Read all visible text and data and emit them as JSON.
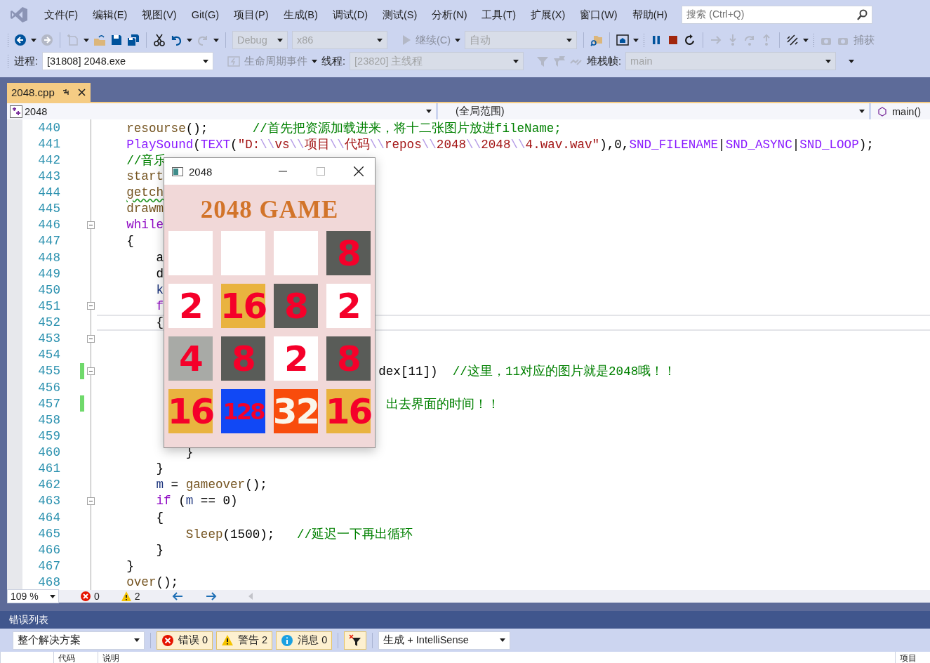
{
  "menu": {
    "items": [
      "文件(F)",
      "编辑(E)",
      "视图(V)",
      "Git(G)",
      "项目(P)",
      "生成(B)",
      "调试(D)",
      "测试(S)",
      "分析(N)",
      "工具(T)",
      "扩展(X)",
      "窗口(W)",
      "帮助(H)"
    ],
    "search": {
      "placeholder": "搜索 (Ctrl+Q)"
    }
  },
  "toolbar": {
    "configuration": {
      "value": "Debug",
      "disabled": true
    },
    "platform": {
      "value": "x86",
      "disabled": true
    },
    "continue": {
      "label": "继续(C)",
      "disabled": true
    },
    "auto": {
      "value": "自动",
      "disabled": true
    },
    "capture": {
      "label": "捕获",
      "disabled": true
    }
  },
  "debug_location": {
    "process_label": "进程:",
    "process": {
      "value": "[31808] 2048.exe",
      "disabled": false
    },
    "lifecycle": "生命周期事件",
    "thread_label": "线程:",
    "thread": {
      "value": "[23820] 主线程",
      "disabled": true
    },
    "stack_label": "堆栈帧:",
    "stack": {
      "value": "main",
      "disabled": true
    }
  },
  "document_tabs": [
    {
      "label": "2048.cpp",
      "selected": true
    }
  ],
  "navigation": {
    "project": "2048",
    "scope": "(全局范围)",
    "member": "main()"
  },
  "code_lines": [
    {
      "number": "440",
      "foldable": false,
      "changed": false,
      "current": false,
      "warning": false,
      "tokens": [
        {
          "kind": "function",
          "text": "    resourse"
        },
        {
          "kind": "plain",
          "text": "();      "
        },
        {
          "kind": "comment",
          "text": "//首先把资源加载进来，将十二张图片放进fileName;"
        }
      ]
    },
    {
      "number": "441",
      "foldable": false,
      "changed": false,
      "current": false,
      "warning": false,
      "tokens": [
        {
          "kind": "macro",
          "text": "    PlaySound"
        },
        {
          "kind": "plain",
          "text": "("
        },
        {
          "kind": "macro",
          "text": "TEXT"
        },
        {
          "kind": "plain",
          "text": "("
        },
        {
          "kind": "string",
          "text": "\"D:"
        },
        {
          "kind": "escape",
          "text": "\\\\"
        },
        {
          "kind": "string",
          "text": "vs"
        },
        {
          "kind": "escape",
          "text": "\\\\"
        },
        {
          "kind": "string",
          "text": "项目"
        },
        {
          "kind": "escape",
          "text": "\\\\"
        },
        {
          "kind": "string",
          "text": "代码"
        },
        {
          "kind": "escape",
          "text": "\\\\"
        },
        {
          "kind": "string",
          "text": "repos"
        },
        {
          "kind": "escape",
          "text": "\\\\"
        },
        {
          "kind": "string",
          "text": "2048"
        },
        {
          "kind": "escape",
          "text": "\\\\"
        },
        {
          "kind": "string",
          "text": "2048"
        },
        {
          "kind": "escape",
          "text": "\\\\"
        },
        {
          "kind": "string",
          "text": "4.wav.wav\""
        },
        {
          "kind": "plain",
          "text": "),0,"
        },
        {
          "kind": "macro",
          "text": "SND_FILENAME"
        },
        {
          "kind": "plain",
          "text": "|"
        },
        {
          "kind": "macro",
          "text": "SND_ASYNC"
        },
        {
          "kind": "plain",
          "text": "|"
        },
        {
          "kind": "macro",
          "text": "SND_LOOP"
        },
        {
          "kind": "plain",
          "text": ");"
        }
      ]
    },
    {
      "number": "442",
      "foldable": false,
      "changed": false,
      "current": false,
      "warning": false,
      "tokens": [
        {
          "kind": "comment",
          "text": "    //音乐"
        }
      ]
    },
    {
      "number": "443",
      "foldable": false,
      "changed": false,
      "current": false,
      "warning": false,
      "tokens": [
        {
          "kind": "function",
          "text": "    start"
        }
      ]
    },
    {
      "number": "444",
      "foldable": false,
      "changed": false,
      "current": false,
      "warning": true,
      "tokens": [
        {
          "kind": "function",
          "text": "    getch"
        }
      ]
    },
    {
      "number": "445",
      "foldable": false,
      "changed": false,
      "current": false,
      "warning": false,
      "tokens": [
        {
          "kind": "function",
          "text": "    drawm"
        }
      ]
    },
    {
      "number": "446",
      "foldable": true,
      "changed": false,
      "current": false,
      "warning": false,
      "tokens": [
        {
          "kind": "keyword",
          "text": "    while"
        }
      ]
    },
    {
      "number": "447",
      "foldable": false,
      "changed": false,
      "current": false,
      "warning": false,
      "tokens": [
        {
          "kind": "plain",
          "text": "    {"
        }
      ]
    },
    {
      "number": "448",
      "foldable": false,
      "changed": false,
      "current": false,
      "warning": false,
      "tokens": [
        {
          "kind": "plain",
          "text": "        a"
        }
      ]
    },
    {
      "number": "449",
      "foldable": false,
      "changed": false,
      "current": false,
      "warning": false,
      "tokens": [
        {
          "kind": "plain",
          "text": "        d"
        }
      ]
    },
    {
      "number": "450",
      "foldable": false,
      "changed": false,
      "current": false,
      "warning": false,
      "tokens": [
        {
          "kind": "variable",
          "text": "        k"
        }
      ]
    },
    {
      "number": "451",
      "foldable": true,
      "changed": false,
      "current": false,
      "warning": false,
      "tokens": [
        {
          "kind": "keyword",
          "text": "        f"
        }
      ]
    },
    {
      "number": "452",
      "foldable": false,
      "changed": false,
      "current": true,
      "warning": false,
      "tokens": [
        {
          "kind": "plain",
          "text": "        {"
        }
      ]
    },
    {
      "number": "453",
      "foldable": true,
      "changed": false,
      "current": false,
      "warning": false
    },
    {
      "number": "454",
      "foldable": false,
      "changed": false,
      "current": false,
      "warning": false
    },
    {
      "number": "455",
      "foldable": true,
      "changed": true,
      "current": false,
      "warning": false,
      "tokens": [
        {
          "kind": "plain",
          "text": "                                      dex[11])  "
        },
        {
          "kind": "comment",
          "text": "//这里，11对应的图片就是2048哦！！"
        }
      ]
    },
    {
      "number": "456",
      "foldable": false,
      "changed": false,
      "current": false,
      "warning": false
    },
    {
      "number": "457",
      "foldable": false,
      "changed": true,
      "current": false,
      "warning": false,
      "tokens": [
        {
          "kind": "comment",
          "text": "                                       出去界面的时间！！"
        }
      ]
    },
    {
      "number": "458",
      "foldable": false,
      "changed": false,
      "current": false,
      "warning": false
    },
    {
      "number": "459",
      "foldable": false,
      "changed": false,
      "current": false,
      "warning": false
    },
    {
      "number": "460",
      "foldable": false,
      "changed": false,
      "current": false,
      "warning": false,
      "tokens": [
        {
          "kind": "plain",
          "text": "            }"
        }
      ]
    },
    {
      "number": "461",
      "foldable": false,
      "changed": false,
      "current": false,
      "warning": false,
      "tokens": [
        {
          "kind": "plain",
          "text": "        }"
        }
      ]
    },
    {
      "number": "462",
      "foldable": false,
      "changed": false,
      "current": false,
      "warning": false,
      "tokens": [
        {
          "kind": "variable",
          "text": "        m"
        },
        {
          "kind": "plain",
          "text": " = "
        },
        {
          "kind": "function",
          "text": "gameover"
        },
        {
          "kind": "plain",
          "text": "();"
        }
      ]
    },
    {
      "number": "463",
      "foldable": true,
      "changed": false,
      "current": false,
      "warning": false,
      "tokens": [
        {
          "kind": "keyword",
          "text": "        if"
        },
        {
          "kind": "plain",
          "text": " ("
        },
        {
          "kind": "variable",
          "text": "m"
        },
        {
          "kind": "plain",
          "text": " == 0)"
        }
      ]
    },
    {
      "number": "464",
      "foldable": false,
      "changed": false,
      "current": false,
      "warning": false,
      "tokens": [
        {
          "kind": "plain",
          "text": "        {"
        }
      ]
    },
    {
      "number": "465",
      "foldable": false,
      "changed": false,
      "current": false,
      "warning": false,
      "tokens": [
        {
          "kind": "function",
          "text": "            Sleep"
        },
        {
          "kind": "plain",
          "text": "(1500);   "
        },
        {
          "kind": "comment",
          "text": "//延迟一下再出循环"
        }
      ]
    },
    {
      "number": "466",
      "foldable": false,
      "changed": false,
      "current": false,
      "warning": false,
      "tokens": [
        {
          "kind": "plain",
          "text": "        }"
        }
      ]
    },
    {
      "number": "467",
      "foldable": false,
      "changed": false,
      "current": false,
      "warning": false,
      "tokens": [
        {
          "kind": "plain",
          "text": "    }"
        }
      ]
    },
    {
      "number": "468",
      "foldable": false,
      "changed": false,
      "current": false,
      "warning": false,
      "tokens": [
        {
          "kind": "function",
          "text": "    over"
        },
        {
          "kind": "plain",
          "text": "();"
        }
      ]
    }
  ],
  "editor_status": {
    "zoom": "109 %",
    "errors": "0",
    "warnings": "2"
  },
  "popup": {
    "title": "2048",
    "heading": "2048 GAME",
    "tiles": [
      {
        "kind": "empty",
        "color": "#ffffff"
      },
      {
        "kind": "empty",
        "color": "#ffffff"
      },
      {
        "kind": "empty",
        "color": "#ffffff"
      },
      {
        "kind": "standard",
        "value": "8",
        "color": "#595c58"
      },
      {
        "kind": "standard",
        "value": "2",
        "color": "#ffffff"
      },
      {
        "kind": "standard",
        "value": "16",
        "color": "#e9b33f"
      },
      {
        "kind": "standard",
        "value": "8",
        "color": "#595c58"
      },
      {
        "kind": "standard",
        "value": "2",
        "color": "#ffffff"
      },
      {
        "kind": "standard",
        "value": "4",
        "color": "#a8aaa6"
      },
      {
        "kind": "standard",
        "value": "8",
        "color": "#595c58"
      },
      {
        "kind": "standard",
        "value": "2",
        "color": "#ffffff"
      },
      {
        "kind": "standard",
        "value": "8",
        "color": "#595c58"
      },
      {
        "kind": "standard",
        "value": "16",
        "color": "#e9b33f"
      },
      {
        "kind": "standard",
        "value": "128",
        "color": "#1148f5"
      },
      {
        "kind": "inverse",
        "value": "32",
        "color": "#f84c0c"
      },
      {
        "kind": "standard",
        "value": "16",
        "color": "#e9b33f"
      }
    ]
  },
  "error_list": {
    "title": "错误列表",
    "scope": "整个解决方案",
    "filters": [
      {
        "kind": "error",
        "label": "错误 0",
        "selected": true
      },
      {
        "kind": "warning",
        "label": "警告 2",
        "selected": true
      },
      {
        "kind": "info",
        "label": "消息 0",
        "selected": true
      }
    ],
    "source": "生成 + IntelliSense",
    "columns": [
      "代码",
      "说明",
      "项目"
    ]
  }
}
